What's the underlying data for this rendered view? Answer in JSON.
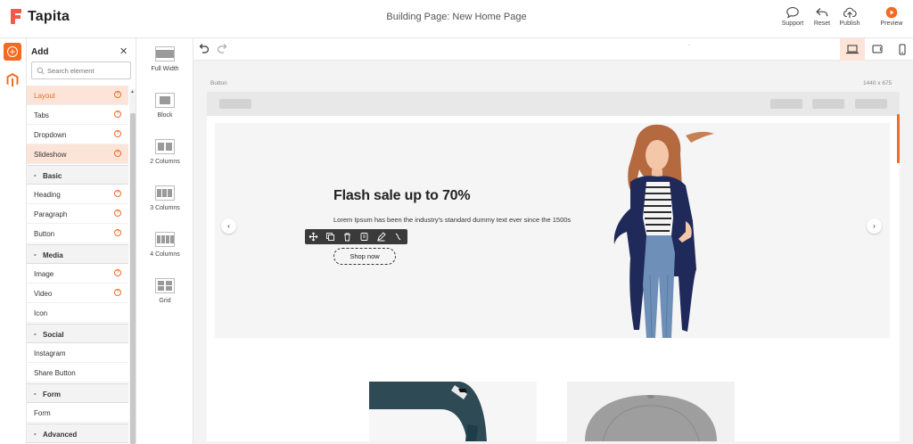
{
  "app": {
    "logo_text": "Tapita",
    "page_title": "Building Page: New Home Page"
  },
  "top_actions": {
    "support": "Support",
    "reset": "Reset",
    "publish": "Publish",
    "preview": "Preview"
  },
  "colors": {
    "accent": "#f26b21",
    "logo": "#f15a4a",
    "active_bg": "#fde4d9"
  },
  "add_panel": {
    "title": "Add",
    "search_placeholder": "Search element",
    "layout_items": [
      {
        "label": "Layout",
        "help": "?"
      },
      {
        "label": "Tabs",
        "help": "?"
      },
      {
        "label": "Dropdown",
        "help": "?"
      },
      {
        "label": "Slideshow",
        "help": "?"
      }
    ],
    "sections": {
      "basic": {
        "label": "Basic",
        "items": [
          "Heading",
          "Paragraph",
          "Button"
        ]
      },
      "media": {
        "label": "Media",
        "items": [
          "Image",
          "Video",
          "Icon"
        ]
      },
      "social": {
        "label": "Social",
        "items": [
          "Instagram",
          "Share Button"
        ]
      },
      "form": {
        "label": "Form",
        "items": [
          "Form"
        ]
      },
      "advanced": {
        "label": "Advanced"
      }
    },
    "section_marker": "-"
  },
  "layouts": [
    {
      "label": "Full Width"
    },
    {
      "label": "Block"
    },
    {
      "label": "2 Columns"
    },
    {
      "label": "3 Columns"
    },
    {
      "label": "4 Columns"
    },
    {
      "label": "Grid"
    }
  ],
  "canvas": {
    "breadcrumb": "Button",
    "size": "1440 x 675",
    "toolbar_dot": "-",
    "devices": [
      "laptop-icon",
      "tablet-icon",
      "mobile-icon"
    ],
    "active_device": "laptop-icon"
  },
  "hero": {
    "title": "Flash sale up to 70%",
    "text": "Lorem Ipsum has been the industry's standard dummy text ever since the 1500s",
    "button": "Shop now",
    "prev": "‹",
    "next": "›"
  },
  "edit_tools": [
    "move-icon",
    "duplicate-icon",
    "delete-icon",
    "copy-style-icon",
    "edit-icon",
    "more-icon"
  ]
}
